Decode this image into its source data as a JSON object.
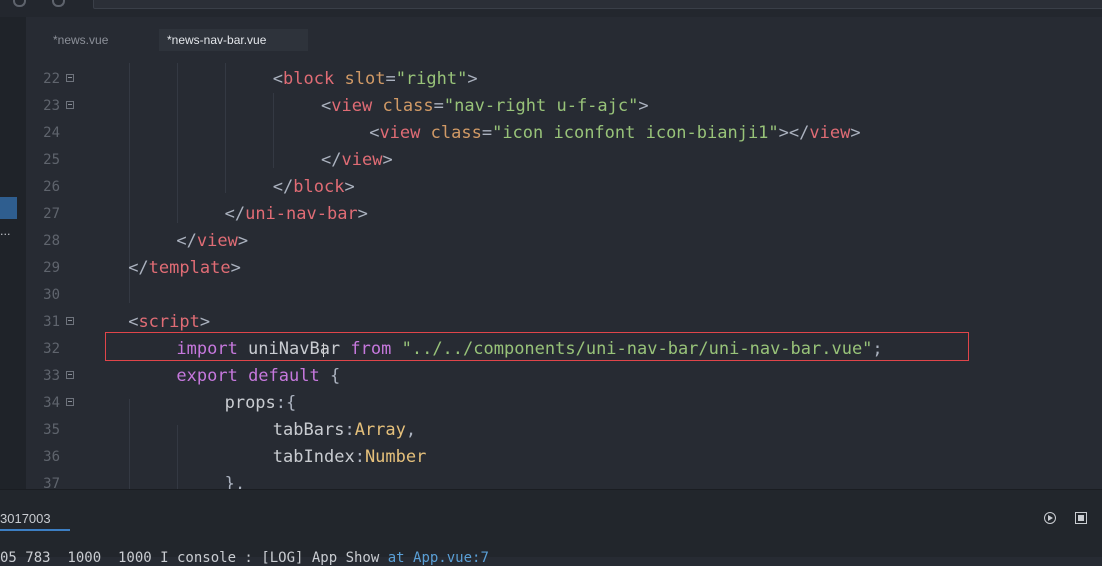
{
  "tabs": [
    {
      "label": "*news.vue"
    },
    {
      "label": "*news-nav-bar.vue"
    }
  ],
  "left_panel": {
    "ellipsis": "..."
  },
  "lines": [
    {
      "num": "22",
      "tokens": [
        {
          "t": "<",
          "c": "pun"
        },
        {
          "t": "block",
          "c": "tag"
        },
        {
          "t": " ",
          "c": "plain"
        },
        {
          "t": "slot",
          "c": "attr"
        },
        {
          "t": "=",
          "c": "pun"
        },
        {
          "t": "\"right\"",
          "c": "str"
        },
        {
          "t": ">",
          "c": "pun"
        }
      ]
    },
    {
      "num": "23",
      "tokens": [
        {
          "t": "<",
          "c": "pun"
        },
        {
          "t": "view",
          "c": "tag"
        },
        {
          "t": " ",
          "c": "plain"
        },
        {
          "t": "class",
          "c": "attr"
        },
        {
          "t": "=",
          "c": "pun"
        },
        {
          "t": "\"nav-right u-f-ajc\"",
          "c": "str"
        },
        {
          "t": ">",
          "c": "pun"
        }
      ]
    },
    {
      "num": "24",
      "tokens": [
        {
          "t": "<",
          "c": "pun"
        },
        {
          "t": "view",
          "c": "tag"
        },
        {
          "t": " ",
          "c": "plain"
        },
        {
          "t": "class",
          "c": "attr"
        },
        {
          "t": "=",
          "c": "pun"
        },
        {
          "t": "\"icon iconfont icon-bianji1\"",
          "c": "str"
        },
        {
          "t": "></",
          "c": "pun"
        },
        {
          "t": "view",
          "c": "tag"
        },
        {
          "t": ">",
          "c": "pun"
        }
      ]
    },
    {
      "num": "25",
      "tokens": [
        {
          "t": "</",
          "c": "pun"
        },
        {
          "t": "view",
          "c": "tag"
        },
        {
          "t": ">",
          "c": "pun"
        }
      ]
    },
    {
      "num": "26",
      "tokens": [
        {
          "t": "</",
          "c": "pun"
        },
        {
          "t": "block",
          "c": "tag"
        },
        {
          "t": ">",
          "c": "pun"
        }
      ]
    },
    {
      "num": "27",
      "tokens": [
        {
          "t": "</",
          "c": "pun"
        },
        {
          "t": "uni-nav-bar",
          "c": "tag"
        },
        {
          "t": ">",
          "c": "pun"
        }
      ]
    },
    {
      "num": "28",
      "tokens": [
        {
          "t": "</",
          "c": "pun"
        },
        {
          "t": "view",
          "c": "tag"
        },
        {
          "t": ">",
          "c": "pun"
        }
      ]
    },
    {
      "num": "29",
      "tokens": [
        {
          "t": "</",
          "c": "pun"
        },
        {
          "t": "template",
          "c": "tag"
        },
        {
          "t": ">",
          "c": "pun"
        }
      ]
    },
    {
      "num": "30",
      "tokens": []
    },
    {
      "num": "31",
      "tokens": [
        {
          "t": "<",
          "c": "pun"
        },
        {
          "t": "script",
          "c": "tag"
        },
        {
          "t": ">",
          "c": "pun"
        }
      ]
    },
    {
      "num": "32",
      "tokens": [
        {
          "t": "import",
          "c": "kw"
        },
        {
          "t": " uniNavBar ",
          "c": "plain"
        },
        {
          "t": "from",
          "c": "kw"
        },
        {
          "t": " ",
          "c": "plain"
        },
        {
          "t": "\"../../components/uni-nav-bar/uni-nav-bar.vue\"",
          "c": "str"
        },
        {
          "t": ";",
          "c": "pun"
        }
      ]
    },
    {
      "num": "33",
      "tokens": [
        {
          "t": "export",
          "c": "kw"
        },
        {
          "t": " ",
          "c": "plain"
        },
        {
          "t": "default",
          "c": "kw"
        },
        {
          "t": " {",
          "c": "pun"
        }
      ]
    },
    {
      "num": "34",
      "tokens": [
        {
          "t": "props",
          "c": "plain"
        },
        {
          "t": ":{",
          "c": "pun"
        }
      ]
    },
    {
      "num": "35",
      "tokens": [
        {
          "t": "tabBars",
          "c": "plain"
        },
        {
          "t": ":",
          "c": "pun"
        },
        {
          "t": "Array",
          "c": "type"
        },
        {
          "t": ",",
          "c": "pun"
        }
      ]
    },
    {
      "num": "36",
      "tokens": [
        {
          "t": "tabIndex",
          "c": "plain"
        },
        {
          "t": ":",
          "c": "pun"
        },
        {
          "t": "Number",
          "c": "type"
        }
      ]
    },
    {
      "num": "37",
      "tokens": [
        {
          "t": "},",
          "c": "pun"
        }
      ]
    }
  ],
  "bottom_panel": {
    "process_id": "3017003",
    "console_text": "05 783  1000  1000 I console : [LOG] App Show ",
    "console_link": "at App.vue:7"
  },
  "colors": {
    "background": "#272b33",
    "tag": "#e06c75",
    "attribute": "#d19a66",
    "string": "#98c379",
    "keyword": "#c678dd",
    "type": "#e5c07b",
    "highlight_box": "#e0454a"
  }
}
